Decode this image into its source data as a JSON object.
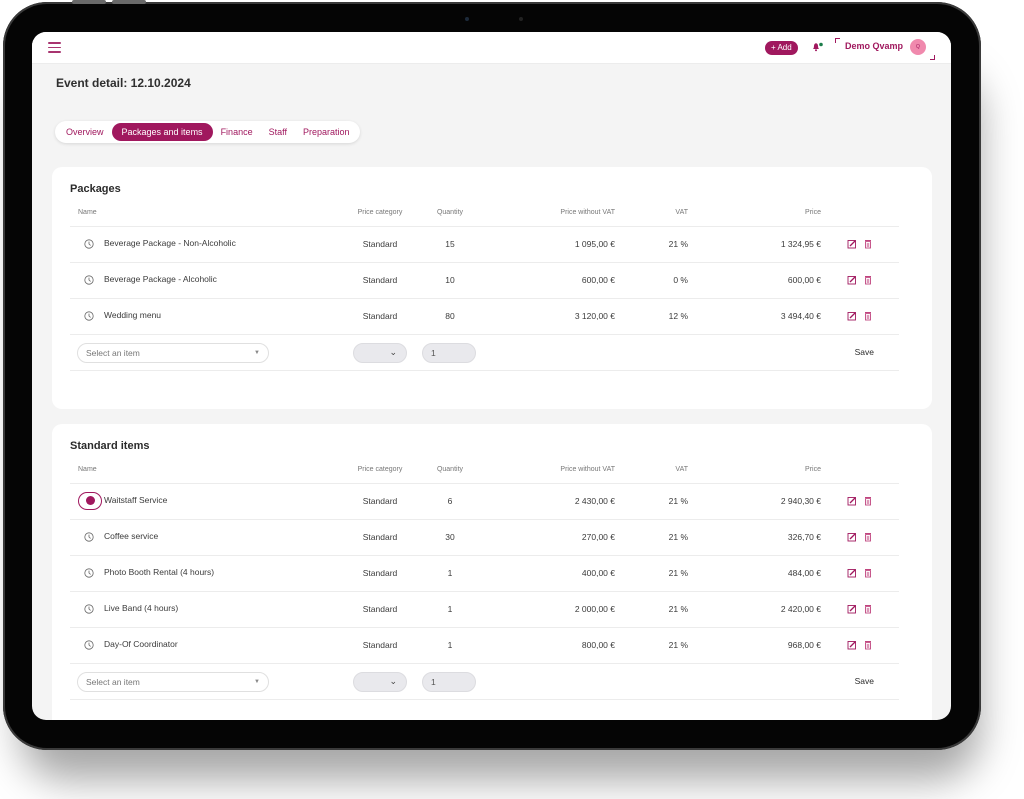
{
  "colors": {
    "accent": "#a0185e",
    "avatar_bg": "#f089ad",
    "notification_dot": "#1c7d4a"
  },
  "header": {
    "menu_icon": "hamburger-icon",
    "add_label": "+ Add",
    "bell_icon": "bell-icon",
    "user_name": "Demo Qvamp",
    "avatar_initial": "Q"
  },
  "page": {
    "title": "Event detail: 12.10.2024"
  },
  "tabs": [
    {
      "label": "Overview",
      "active": false
    },
    {
      "label": "Packages and items",
      "active": true
    },
    {
      "label": "Finance",
      "active": false
    },
    {
      "label": "Staff",
      "active": false
    },
    {
      "label": "Preparation",
      "active": false
    }
  ],
  "columns": {
    "name": "Name",
    "price_category": "Price category",
    "quantity": "Quantity",
    "price_without_vat": "Price without VAT",
    "vat": "VAT",
    "price": "Price"
  },
  "packages": {
    "title": "Packages",
    "rows": [
      {
        "name": "Beverage Package - Non-Alcoholic",
        "category": "Standard",
        "quantity": "15",
        "price_without_vat": "1 095,00 €",
        "vat": "21 %",
        "price": "1 324,95 €"
      },
      {
        "name": "Beverage Package - Alcoholic",
        "category": "Standard",
        "quantity": "10",
        "price_without_vat": "600,00 €",
        "vat": "0 %",
        "price": "600,00 €"
      },
      {
        "name": "Wedding menu",
        "category": "Standard",
        "quantity": "80",
        "price_without_vat": "3 120,00 €",
        "vat": "12 %",
        "price": "3 494,40 €"
      }
    ],
    "add_row": {
      "select_placeholder": "Select an item",
      "quantity_value": "1",
      "save_label": "Save"
    }
  },
  "standard_items": {
    "title": "Standard items",
    "rows": [
      {
        "name": "Waitstaff Service",
        "category": "Standard",
        "quantity": "6",
        "price_without_vat": "2 430,00 €",
        "vat": "21 %",
        "price": "2 940,30 €",
        "clock_active": true
      },
      {
        "name": "Coffee service",
        "category": "Standard",
        "quantity": "30",
        "price_without_vat": "270,00 €",
        "vat": "21 %",
        "price": "326,70 €"
      },
      {
        "name": "Photo Booth Rental (4 hours)",
        "category": "Standard",
        "quantity": "1",
        "price_without_vat": "400,00 €",
        "vat": "21 %",
        "price": "484,00 €"
      },
      {
        "name": "Live Band (4 hours)",
        "category": "Standard",
        "quantity": "1",
        "price_without_vat": "2 000,00 €",
        "vat": "21 %",
        "price": "2 420,00 €"
      },
      {
        "name": "Day-Of Coordinator",
        "category": "Standard",
        "quantity": "1",
        "price_without_vat": "800,00 €",
        "vat": "21 %",
        "price": "968,00 €"
      }
    ],
    "add_row": {
      "select_placeholder": "Select an item",
      "quantity_value": "1",
      "save_label": "Save"
    }
  }
}
